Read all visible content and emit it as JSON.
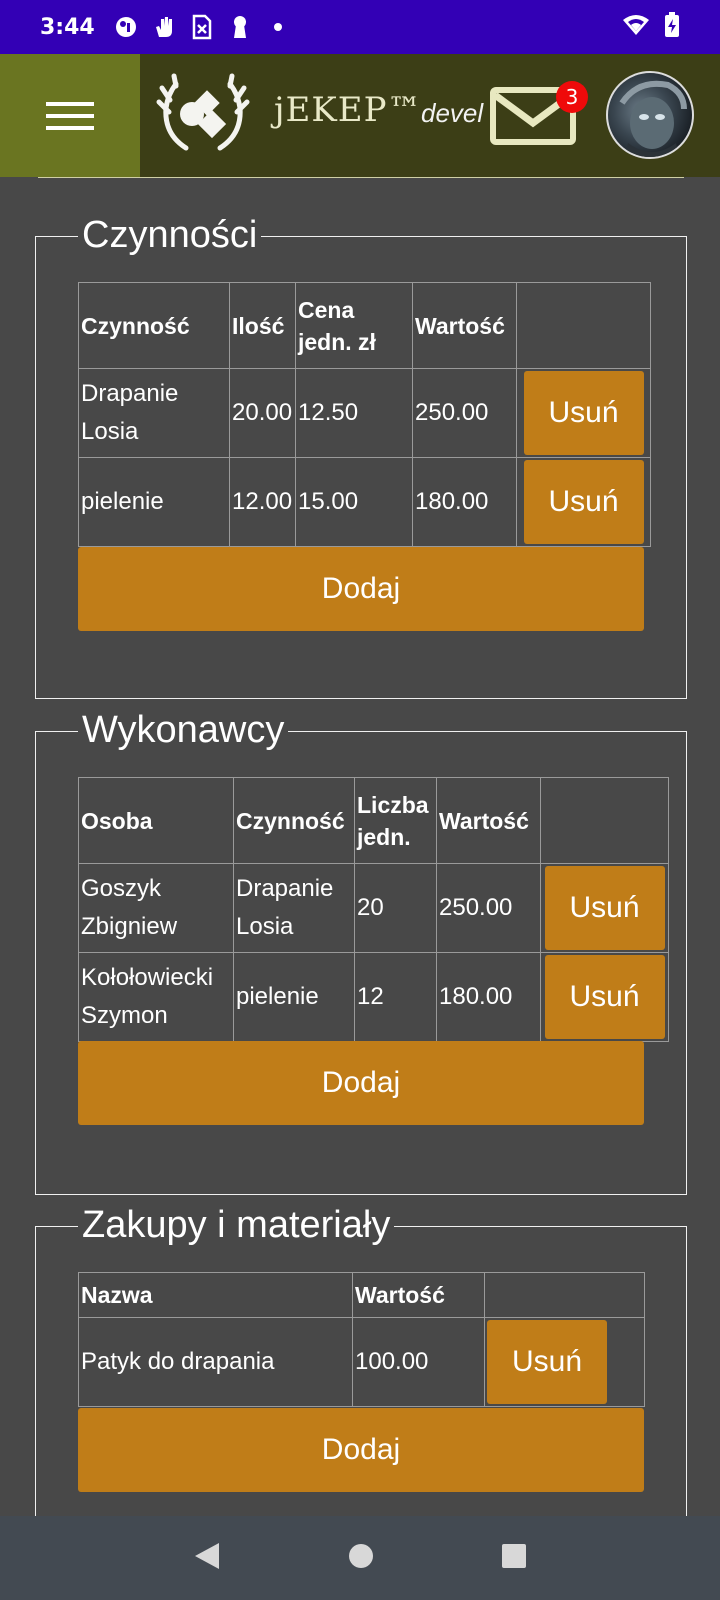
{
  "status_bar": {
    "time": "3:44",
    "icons": [
      "messenger-icon",
      "hand-icon",
      "sim-icon",
      "keyhole-icon",
      "dot-icon"
    ],
    "right_icons": [
      "wifi-icon",
      "battery-charging-icon"
    ]
  },
  "header": {
    "brand": "jEKEP™",
    "env": "devel",
    "mail_count": "3",
    "colors": {
      "menu_bg": "#6a7521",
      "bar_bg": "#3c3e16",
      "status_bg": "#3300b5",
      "accent": "#c07d18",
      "badge": "#ef0a0a"
    }
  },
  "czynnosci": {
    "title": "Czynności",
    "headers": [
      "Czynność",
      "Ilość",
      "Cena jedn. zł",
      "Wartość"
    ],
    "rows": [
      {
        "name": "Drapanie Losia",
        "qty": "20.00",
        "price": "12.50",
        "value": "250.00",
        "delete": "Usuń"
      },
      {
        "name": "pielenie",
        "qty": "12.00",
        "price": "15.00",
        "value": "180.00",
        "delete": "Usuń"
      }
    ],
    "add": "Dodaj"
  },
  "wykonawcy": {
    "title": "Wykonawcy",
    "headers": [
      "Osoba",
      "Czynność",
      "Liczba jedn.",
      "Wartość"
    ],
    "rows": [
      {
        "person": "Goszyk Zbigniew",
        "activity": "Drapanie Losia",
        "units": "20",
        "value": "250.00",
        "delete": "Usuń"
      },
      {
        "person": "Kołołowiecki Szymon",
        "activity": "pielenie",
        "units": "12",
        "value": "180.00",
        "delete": "Usuń"
      }
    ],
    "add": "Dodaj"
  },
  "zakupy": {
    "title": "Zakupy i materiały",
    "headers": [
      "Nazwa",
      "Wartość"
    ],
    "rows": [
      {
        "name": "Patyk do drapania",
        "value": "100.00",
        "delete": "Usuń"
      }
    ],
    "add": "Dodaj"
  },
  "nav": {
    "icons": [
      "back-icon",
      "home-icon",
      "recents-icon"
    ]
  }
}
